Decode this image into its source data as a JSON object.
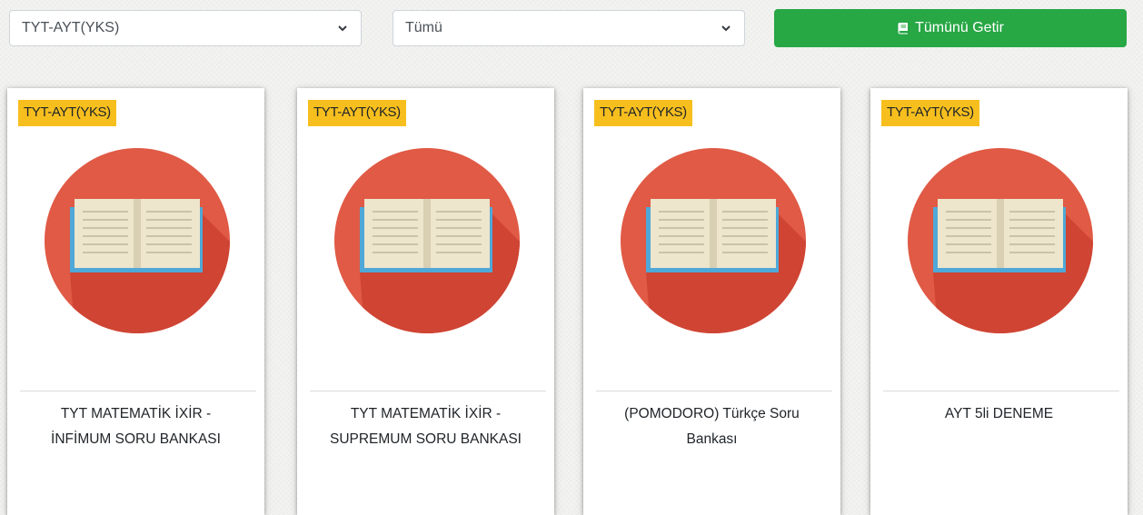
{
  "toolbar": {
    "category_select": {
      "value": "TYT-AYT(YKS)"
    },
    "filter_select": {
      "value": "Tümü"
    },
    "fetch_button": {
      "label": "Tümünü Getir",
      "icon": "book-icon",
      "color": "#28a745"
    }
  },
  "colors": {
    "badge": "#f7bf1e",
    "circle": "#e05a45",
    "book_cover": "#4fa8d8",
    "page": "#f2ecd8"
  },
  "cards": [
    {
      "badge": "TYT-AYT(YKS)",
      "image_icon": "open-book-icon",
      "title": "TYT MATEMATİK İXİR - İNFİMUM SORU BANKASI"
    },
    {
      "badge": "TYT-AYT(YKS)",
      "image_icon": "open-book-icon",
      "title": "TYT MATEMATİK İXİR - SUPREMUM SORU BANKASI"
    },
    {
      "badge": "TYT-AYT(YKS)",
      "image_icon": "open-book-icon",
      "title": "(POMODORO) Türkçe Soru Bankası"
    },
    {
      "badge": "TYT-AYT(YKS)",
      "image_icon": "open-book-icon",
      "title": "AYT 5li DENEME"
    }
  ]
}
